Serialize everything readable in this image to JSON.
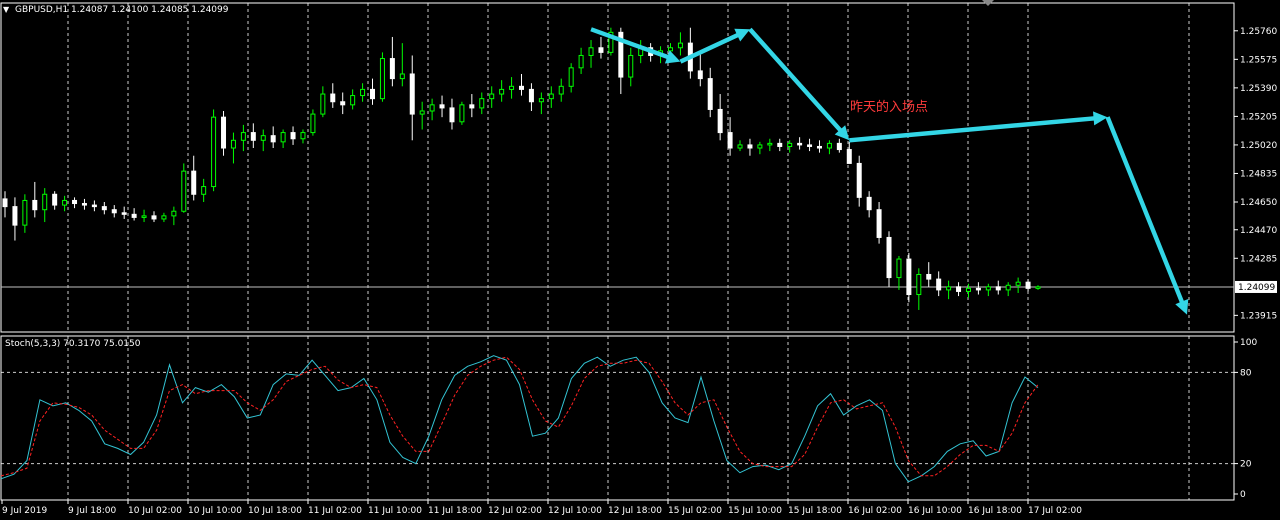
{
  "header": {
    "menu_icon": "triangle-down-icon",
    "symbol_info": "GBPUSD,H1  1.24087 1.24100 1.24085 1.24099"
  },
  "annotation": {
    "text": "昨天的入场点",
    "color": "#ff3b3b"
  },
  "colors": {
    "background": "#000000",
    "bull": "#00ff00",
    "bear": "#ffffff",
    "arrow": "#33d6e6",
    "stoch_main": "#33c4d4",
    "stoch_signal": "#ff2222",
    "axis": "#ffffff",
    "grid": "#ffffff"
  },
  "chart_data": [
    {
      "type": "candlestick",
      "title": "GBPUSD,H1",
      "ohlc_header": "1.24087 1.24100 1.24085 1.24099",
      "y_ticks": [
        "1.25760",
        "1.25575",
        "1.25390",
        "1.25205",
        "1.25020",
        "1.24835",
        "1.24650",
        "1.24470",
        "1.24285",
        "1.23915"
      ],
      "ylim": [
        1.2382,
        1.2583
      ],
      "current_price_label": "1.24099",
      "current_price": 1.24099,
      "grid": "dashed",
      "ohlc": [
        [
          1.2467,
          1.2472,
          1.2455,
          1.2462
        ],
        [
          1.2462,
          1.2468,
          1.244,
          1.245
        ],
        [
          1.245,
          1.247,
          1.2445,
          1.2466
        ],
        [
          1.2466,
          1.2478,
          1.2455,
          1.246
        ],
        [
          1.246,
          1.2474,
          1.2452,
          1.247
        ],
        [
          1.247,
          1.2472,
          1.246,
          1.2463
        ],
        [
          1.2463,
          1.2469,
          1.2459,
          1.2466
        ],
        [
          1.2466,
          1.2468,
          1.2461,
          1.2464
        ],
        [
          1.2464,
          1.2467,
          1.246,
          1.2463
        ],
        [
          1.2463,
          1.2466,
          1.2459,
          1.2462
        ],
        [
          1.2462,
          1.2465,
          1.2457,
          1.246
        ],
        [
          1.246,
          1.2463,
          1.2455,
          1.2458
        ],
        [
          1.2458,
          1.2462,
          1.2454,
          1.2457
        ],
        [
          1.2457,
          1.2461,
          1.2453,
          1.2455
        ],
        [
          1.2455,
          1.246,
          1.2452,
          1.2456
        ],
        [
          1.2456,
          1.2459,
          1.2452,
          1.2454
        ],
        [
          1.2454,
          1.2458,
          1.2452,
          1.2456
        ],
        [
          1.2456,
          1.2462,
          1.245,
          1.2459
        ],
        [
          1.2459,
          1.249,
          1.2458,
          1.2485
        ],
        [
          1.2485,
          1.2495,
          1.2466,
          1.247
        ],
        [
          1.247,
          1.248,
          1.2465,
          1.2475
        ],
        [
          1.2475,
          1.2525,
          1.2472,
          1.252
        ],
        [
          1.252,
          1.2524,
          1.2495,
          1.25
        ],
        [
          1.25,
          1.251,
          1.249,
          1.2505
        ],
        [
          1.2505,
          1.2515,
          1.2498,
          1.251
        ],
        [
          1.251,
          1.2516,
          1.25,
          1.2505
        ],
        [
          1.2505,
          1.2512,
          1.2498,
          1.2508
        ],
        [
          1.2508,
          1.2514,
          1.25,
          1.2504
        ],
        [
          1.2504,
          1.2512,
          1.25,
          1.251
        ],
        [
          1.251,
          1.2514,
          1.2502,
          1.2506
        ],
        [
          1.2506,
          1.2512,
          1.2503,
          1.251
        ],
        [
          1.251,
          1.2525,
          1.2508,
          1.2522
        ],
        [
          1.2522,
          1.254,
          1.252,
          1.2535
        ],
        [
          1.2535,
          1.2542,
          1.2526,
          1.253
        ],
        [
          1.253,
          1.2536,
          1.2522,
          1.2528
        ],
        [
          1.2528,
          1.2538,
          1.2525,
          1.2534
        ],
        [
          1.2534,
          1.2542,
          1.253,
          1.2538
        ],
        [
          1.2538,
          1.2545,
          1.2528,
          1.2532
        ],
        [
          1.2532,
          1.2562,
          1.253,
          1.2558
        ],
        [
          1.2558,
          1.2572,
          1.254,
          1.2545
        ],
        [
          1.2545,
          1.2568,
          1.254,
          1.2548
        ],
        [
          1.2548,
          1.256,
          1.2505,
          1.2522
        ],
        [
          1.2522,
          1.253,
          1.2512,
          1.2524
        ],
        [
          1.2524,
          1.2532,
          1.2518,
          1.2528
        ],
        [
          1.2528,
          1.2534,
          1.252,
          1.2526
        ],
        [
          1.2526,
          1.2532,
          1.2512,
          1.2517
        ],
        [
          1.2517,
          1.253,
          1.2515,
          1.2528
        ],
        [
          1.2528,
          1.2535,
          1.252,
          1.2526
        ],
        [
          1.2526,
          1.2536,
          1.2522,
          1.2532
        ],
        [
          1.2532,
          1.254,
          1.2526,
          1.2535
        ],
        [
          1.2535,
          1.2544,
          1.253,
          1.2538
        ],
        [
          1.2538,
          1.2546,
          1.2532,
          1.254
        ],
        [
          1.254,
          1.2548,
          1.2534,
          1.2538
        ],
        [
          1.2538,
          1.2542,
          1.2524,
          1.253
        ],
        [
          1.253,
          1.2536,
          1.2522,
          1.2532
        ],
        [
          1.2532,
          1.254,
          1.2526,
          1.2535
        ],
        [
          1.2535,
          1.2545,
          1.253,
          1.254
        ],
        [
          1.254,
          1.2555,
          1.2536,
          1.2552
        ],
        [
          1.2552,
          1.2565,
          1.2548,
          1.256
        ],
        [
          1.256,
          1.257,
          1.2552,
          1.2565
        ],
        [
          1.2565,
          1.2572,
          1.2558,
          1.2562
        ],
        [
          1.2562,
          1.2578,
          1.256,
          1.2575
        ],
        [
          1.2575,
          1.2578,
          1.2535,
          1.2546
        ],
        [
          1.2546,
          1.2565,
          1.254,
          1.256
        ],
        [
          1.256,
          1.257,
          1.2555,
          1.2565
        ],
        [
          1.2565,
          1.2568,
          1.2556,
          1.256
        ],
        [
          1.256,
          1.2566,
          1.2555,
          1.2563
        ],
        [
          1.2563,
          1.2568,
          1.2558,
          1.2565
        ],
        [
          1.2565,
          1.2575,
          1.256,
          1.2568
        ],
        [
          1.2568,
          1.2578,
          1.2545,
          1.255
        ],
        [
          1.255,
          1.2562,
          1.254,
          1.2545
        ],
        [
          1.2545,
          1.2552,
          1.252,
          1.2525
        ],
        [
          1.2525,
          1.2535,
          1.2505,
          1.251
        ],
        [
          1.251,
          1.252,
          1.2495,
          1.25
        ],
        [
          1.25,
          1.2505,
          1.2498,
          1.2502
        ],
        [
          1.2502,
          1.2506,
          1.2495,
          1.25
        ],
        [
          1.25,
          1.2504,
          1.2496,
          1.2502
        ],
        [
          1.2502,
          1.2506,
          1.2498,
          1.2503
        ],
        [
          1.2503,
          1.2506,
          1.2498,
          1.2501
        ],
        [
          1.2501,
          1.2505,
          1.2497,
          1.2503
        ],
        [
          1.2503,
          1.2507,
          1.2499,
          1.2502
        ],
        [
          1.2502,
          1.2506,
          1.2498,
          1.2501
        ],
        [
          1.2501,
          1.2505,
          1.2497,
          1.25
        ],
        [
          1.25,
          1.2505,
          1.2496,
          1.2503
        ],
        [
          1.2503,
          1.2506,
          1.2497,
          1.2499
        ],
        [
          1.2499,
          1.2504,
          1.2494,
          1.249
        ],
        [
          1.249,
          1.2495,
          1.2462,
          1.2468
        ],
        [
          1.2468,
          1.2472,
          1.2455,
          1.246
        ],
        [
          1.246,
          1.2465,
          1.2438,
          1.2442
        ],
        [
          1.2442,
          1.2446,
          1.241,
          1.2416
        ],
        [
          1.2416,
          1.243,
          1.2408,
          1.2428
        ],
        [
          1.2428,
          1.2432,
          1.24,
          1.2405
        ],
        [
          1.2405,
          1.2422,
          1.2395,
          1.2418
        ],
        [
          1.2418,
          1.2426,
          1.241,
          1.2415
        ],
        [
          1.2415,
          1.242,
          1.2404,
          1.2408
        ],
        [
          1.2408,
          1.2414,
          1.2402,
          1.241
        ],
        [
          1.241,
          1.2413,
          1.2404,
          1.2407
        ],
        [
          1.2407,
          1.2412,
          1.2403,
          1.2409
        ],
        [
          1.2409,
          1.2413,
          1.2405,
          1.2408
        ],
        [
          1.2408,
          1.2412,
          1.2404,
          1.241
        ],
        [
          1.241,
          1.2414,
          1.2405,
          1.2408
        ],
        [
          1.2408,
          1.2413,
          1.2404,
          1.2411
        ],
        [
          1.2411,
          1.2416,
          1.2406,
          1.2413
        ],
        [
          1.2413,
          1.2415,
          1.2407,
          1.2409
        ],
        [
          1.2409,
          1.2411,
          1.2408,
          1.241
        ]
      ],
      "arrows": [
        [
          [
            0,
            1.2577
          ],
          [
            9,
            1.2556
          ]
        ],
        [
          [
            9,
            1.2556
          ],
          [
            16,
            1.2577
          ]
        ],
        [
          [
            16,
            1.2577
          ],
          [
            26,
            1.2505
          ]
        ],
        [
          [
            26,
            1.2505
          ],
          [
            52,
            1.252
          ]
        ],
        [
          [
            52,
            1.252
          ],
          [
            60,
            1.2392
          ]
        ]
      ]
    },
    {
      "type": "line",
      "title": "Stoch(5,3,3) 70.3170 75.0150",
      "y_ticks": [
        "100",
        "80",
        "20",
        "0"
      ],
      "ylim": [
        0,
        100
      ],
      "levels": [
        80,
        20
      ],
      "series": [
        {
          "values": [
            10,
            13,
            22,
            62,
            58,
            60,
            55,
            48,
            33,
            30,
            26,
            34,
            52,
            85,
            60,
            70,
            67,
            72,
            64,
            50,
            52,
            72,
            79,
            78,
            88,
            78,
            68,
            70,
            76,
            62,
            34,
            24,
            20,
            38,
            62,
            78,
            84,
            87,
            91,
            88,
            72,
            38,
            40,
            50,
            76,
            86,
            90,
            84,
            88,
            90,
            80,
            60,
            50,
            47,
            77,
            48,
            22,
            14,
            18,
            19,
            16,
            20,
            38,
            58,
            66,
            52,
            58,
            62,
            55,
            20,
            8,
            12,
            18,
            28,
            33,
            35,
            25,
            28,
            60,
            77,
            70
          ]
        },
        {
          "values": [
            12,
            14,
            17,
            48,
            60,
            59,
            57,
            52,
            42,
            36,
            30,
            30,
            42,
            68,
            72,
            66,
            68,
            68,
            68,
            60,
            55,
            62,
            74,
            78,
            82,
            84,
            75,
            70,
            72,
            70,
            52,
            38,
            28,
            28,
            46,
            65,
            78,
            84,
            88,
            90,
            82,
            62,
            48,
            44,
            58,
            76,
            84,
            86,
            86,
            88,
            86,
            74,
            60,
            52,
            60,
            62,
            44,
            28,
            20,
            18,
            18,
            18,
            26,
            44,
            60,
            62,
            56,
            58,
            60,
            44,
            22,
            12,
            12,
            18,
            26,
            32,
            32,
            28,
            40,
            60,
            72
          ]
        }
      ]
    }
  ],
  "x_axis": {
    "labels": [
      "9 Jul 2019",
      "9 Jul 18:00",
      "10 Jul 02:00",
      "10 Jul 10:00",
      "10 Jul 18:00",
      "11 Jul 02:00",
      "11 Jul 10:00",
      "11 Jul 18:00",
      "12 Jul 02:00",
      "12 Jul 10:00",
      "12 Jul 18:00",
      "15 Jul 02:00",
      "15 Jul 10:00",
      "15 Jul 18:00",
      "16 Jul 02:00",
      "16 Jul 10:00",
      "16 Jul 18:00",
      "17 Jul 02:00"
    ]
  }
}
